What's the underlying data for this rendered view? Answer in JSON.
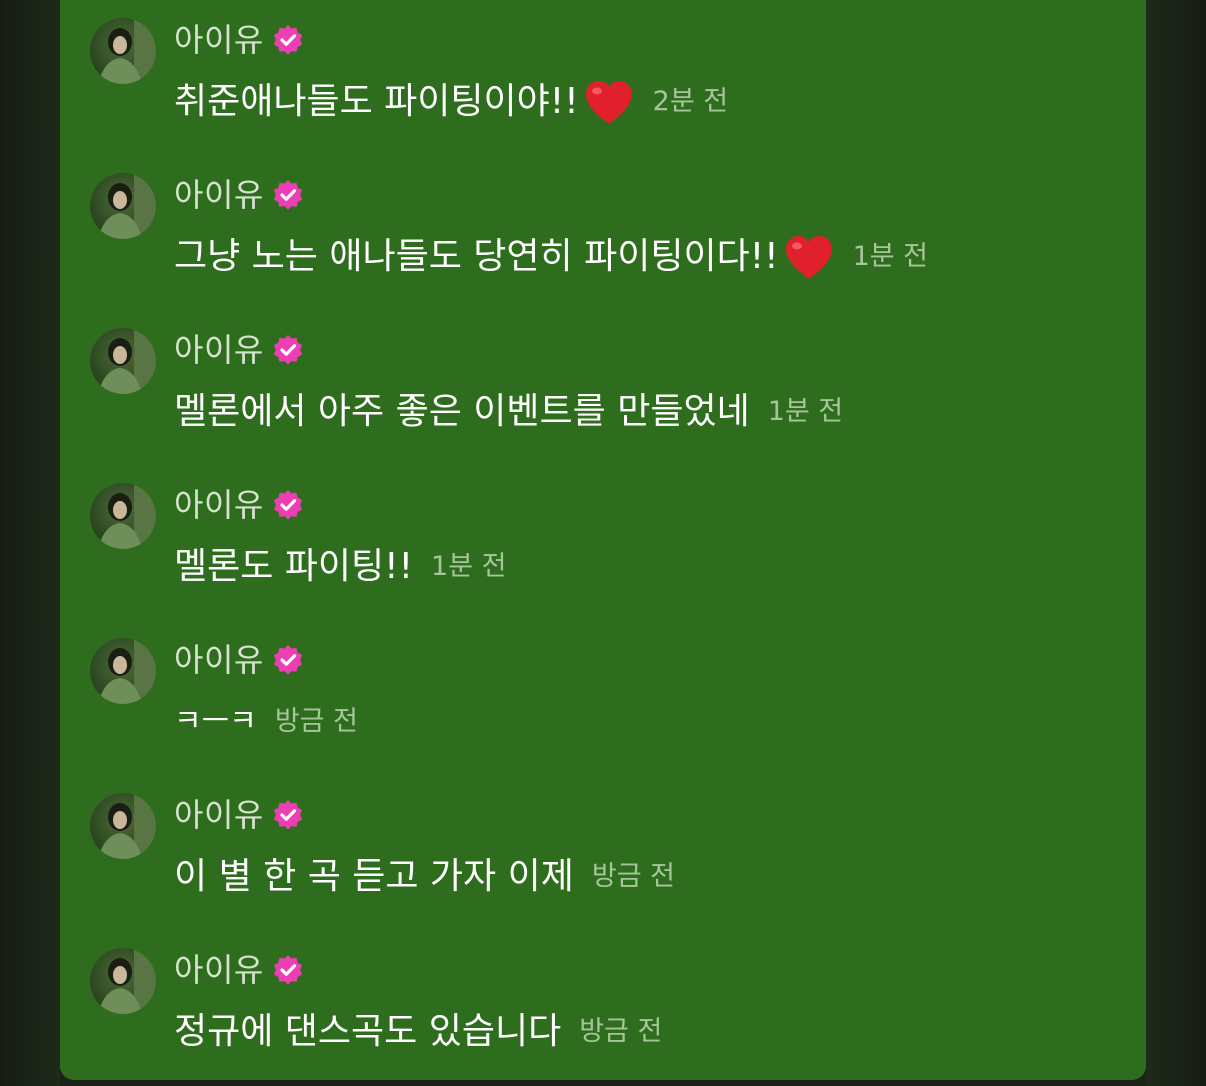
{
  "messages": [
    {
      "author": "아이유",
      "text": "취준애나들도 파이팅이야!!",
      "emoji": "heart",
      "time": "2분 전"
    },
    {
      "author": "아이유",
      "text": "그냥 노는 애나들도 당연히 파이팅이다!!",
      "emoji": "heart",
      "time": "1분 전"
    },
    {
      "author": "아이유",
      "text": "멜론에서 아주 좋은 이벤트를 만들었네",
      "emoji": "",
      "time": "1분 전"
    },
    {
      "author": "아이유",
      "text": "멜론도 파이팅!!",
      "emoji": "",
      "time": "1분 전"
    },
    {
      "author": "아이유",
      "text": "ㅋㅡㅋ",
      "emoji": "",
      "time": "방금 전"
    },
    {
      "author": "아이유",
      "text": "이 별 한 곡 듣고 가자 이제",
      "emoji": "",
      "time": "방금 전"
    },
    {
      "author": "아이유",
      "text": "정규에 댄스곡도 있습니다",
      "emoji": "",
      "time": "방금 전"
    }
  ],
  "colors": {
    "panel": "#2f6d1e",
    "verified_badge": "#ec3fb3",
    "timestamp": "#a7c59a"
  }
}
